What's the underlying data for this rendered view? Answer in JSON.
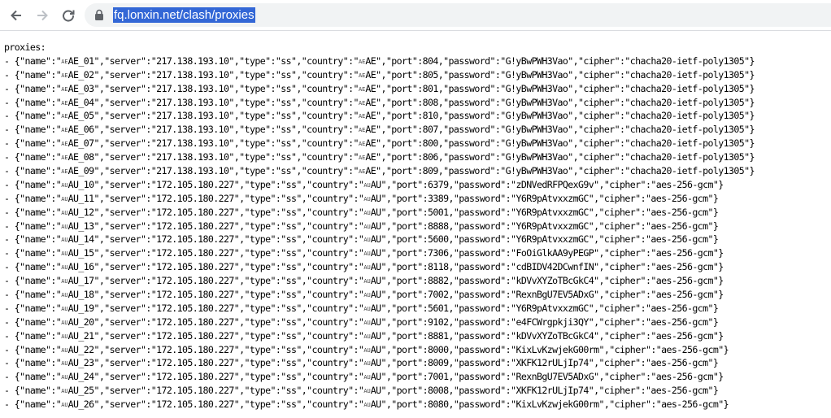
{
  "browser": {
    "url": "fq.lonxin.net/clash/proxies"
  },
  "content": {
    "header": "proxies:",
    "proxies": [
      {
        "flag": "AE",
        "name": "AE_01",
        "server": "217.138.193.10",
        "type": "ss",
        "country": "AE",
        "port": "804",
        "password": "G!yBwPWH3Vao",
        "cipher": "chacha20-ietf-poly1305"
      },
      {
        "flag": "AE",
        "name": "AE_02",
        "server": "217.138.193.10",
        "type": "ss",
        "country": "AE",
        "port": "805",
        "password": "G!yBwPWH3Vao",
        "cipher": "chacha20-ietf-poly1305"
      },
      {
        "flag": "AE",
        "name": "AE_03",
        "server": "217.138.193.10",
        "type": "ss",
        "country": "AE",
        "port": "801",
        "password": "G!yBwPWH3Vao",
        "cipher": "chacha20-ietf-poly1305"
      },
      {
        "flag": "AE",
        "name": "AE_04",
        "server": "217.138.193.10",
        "type": "ss",
        "country": "AE",
        "port": "808",
        "password": "G!yBwPWH3Vao",
        "cipher": "chacha20-ietf-poly1305"
      },
      {
        "flag": "AE",
        "name": "AE_05",
        "server": "217.138.193.10",
        "type": "ss",
        "country": "AE",
        "port": "810",
        "password": "G!yBwPWH3Vao",
        "cipher": "chacha20-ietf-poly1305"
      },
      {
        "flag": "AE",
        "name": "AE_06",
        "server": "217.138.193.10",
        "type": "ss",
        "country": "AE",
        "port": "807",
        "password": "G!yBwPWH3Vao",
        "cipher": "chacha20-ietf-poly1305"
      },
      {
        "flag": "AE",
        "name": "AE_07",
        "server": "217.138.193.10",
        "type": "ss",
        "country": "AE",
        "port": "800",
        "password": "G!yBwPWH3Vao",
        "cipher": "chacha20-ietf-poly1305"
      },
      {
        "flag": "AE",
        "name": "AE_08",
        "server": "217.138.193.10",
        "type": "ss",
        "country": "AE",
        "port": "806",
        "password": "G!yBwPWH3Vao",
        "cipher": "chacha20-ietf-poly1305"
      },
      {
        "flag": "AE",
        "name": "AE_09",
        "server": "217.138.193.10",
        "type": "ss",
        "country": "AE",
        "port": "809",
        "password": "G!yBwPWH3Vao",
        "cipher": "chacha20-ietf-poly1305"
      },
      {
        "flag": "AU",
        "name": "AU_10",
        "server": "172.105.180.227",
        "type": "ss",
        "country": "AU",
        "port": "6379",
        "password": "zDNVedRFPQexG9v",
        "cipher": "aes-256-gcm"
      },
      {
        "flag": "AU",
        "name": "AU_11",
        "server": "172.105.180.227",
        "type": "ss",
        "country": "AU",
        "port": "3389",
        "password": "Y6R9pAtvxxzmGC",
        "cipher": "aes-256-gcm"
      },
      {
        "flag": "AU",
        "name": "AU_12",
        "server": "172.105.180.227",
        "type": "ss",
        "country": "AU",
        "port": "5001",
        "password": "Y6R9pAtvxxzmGC",
        "cipher": "aes-256-gcm"
      },
      {
        "flag": "AU",
        "name": "AU_13",
        "server": "172.105.180.227",
        "type": "ss",
        "country": "AU",
        "port": "8888",
        "password": "Y6R9pAtvxxzmGC",
        "cipher": "aes-256-gcm"
      },
      {
        "flag": "AU",
        "name": "AU_14",
        "server": "172.105.180.227",
        "type": "ss",
        "country": "AU",
        "port": "5600",
        "password": "Y6R9pAtvxxzmGC",
        "cipher": "aes-256-gcm"
      },
      {
        "flag": "AU",
        "name": "AU_15",
        "server": "172.105.180.227",
        "type": "ss",
        "country": "AU",
        "port": "7306",
        "password": "FoOiGlkAA9yPEGP",
        "cipher": "aes-256-gcm"
      },
      {
        "flag": "AU",
        "name": "AU_16",
        "server": "172.105.180.227",
        "type": "ss",
        "country": "AU",
        "port": "8118",
        "password": "cdBIDV42DCwnfIN",
        "cipher": "aes-256-gcm"
      },
      {
        "flag": "AU",
        "name": "AU_17",
        "server": "172.105.180.227",
        "type": "ss",
        "country": "AU",
        "port": "8882",
        "password": "kDVvXYZoTBcGkC4",
        "cipher": "aes-256-gcm"
      },
      {
        "flag": "AU",
        "name": "AU_18",
        "server": "172.105.180.227",
        "type": "ss",
        "country": "AU",
        "port": "7002",
        "password": "RexnBgU7EV5ADxG",
        "cipher": "aes-256-gcm"
      },
      {
        "flag": "AU",
        "name": "AU_19",
        "server": "172.105.180.227",
        "type": "ss",
        "country": "AU",
        "port": "5601",
        "password": "Y6R9pAtvxxzmGC",
        "cipher": "aes-256-gcm"
      },
      {
        "flag": "AU",
        "name": "AU_20",
        "server": "172.105.180.227",
        "type": "ss",
        "country": "AU",
        "port": "9102",
        "password": "e4FCWrgpkji3QY",
        "cipher": "aes-256-gcm"
      },
      {
        "flag": "AU",
        "name": "AU_21",
        "server": "172.105.180.227",
        "type": "ss",
        "country": "AU",
        "port": "8881",
        "password": "kDVvXYZoTBcGkC4",
        "cipher": "aes-256-gcm"
      },
      {
        "flag": "AU",
        "name": "AU_22",
        "server": "172.105.180.227",
        "type": "ss",
        "country": "AU",
        "port": "8000",
        "password": "KixLvKzwjekG00rm",
        "cipher": "aes-256-gcm"
      },
      {
        "flag": "AU",
        "name": "AU_23",
        "server": "172.105.180.227",
        "type": "ss",
        "country": "AU",
        "port": "8009",
        "password": "XKFK12rULjIp74",
        "cipher": "aes-256-gcm"
      },
      {
        "flag": "AU",
        "name": "AU_24",
        "server": "172.105.180.227",
        "type": "ss",
        "country": "AU",
        "port": "7001",
        "password": "RexnBgU7EV5ADxG",
        "cipher": "aes-256-gcm"
      },
      {
        "flag": "AU",
        "name": "AU_25",
        "server": "172.105.180.227",
        "type": "ss",
        "country": "AU",
        "port": "8008",
        "password": "XKFK12rULjIp74",
        "cipher": "aes-256-gcm"
      },
      {
        "flag": "AU",
        "name": "AU_26",
        "server": "172.105.180.227",
        "type": "ss",
        "country": "AU",
        "port": "8080",
        "password": "KixLvKzwjekG00rm",
        "cipher": "aes-256-gcm"
      }
    ]
  }
}
